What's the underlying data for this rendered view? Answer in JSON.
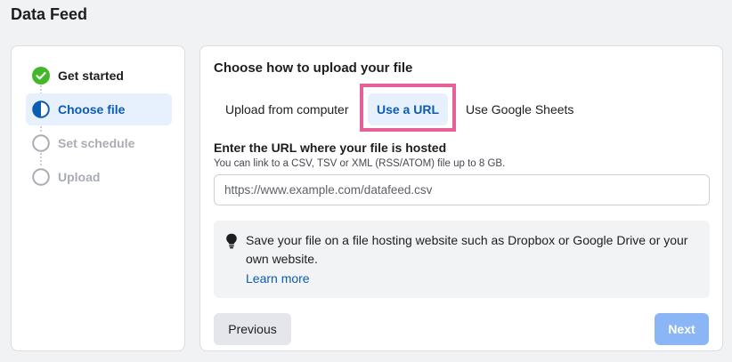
{
  "page": {
    "title": "Data Feed"
  },
  "steps": [
    {
      "label": "Get started",
      "state": "complete",
      "icon": "check-circle-icon"
    },
    {
      "label": "Choose file",
      "state": "current",
      "icon": "half-circle-icon"
    },
    {
      "label": "Set schedule",
      "state": "pending",
      "icon": "empty-circle-icon"
    },
    {
      "label": "Upload",
      "state": "pending",
      "icon": "empty-circle-icon"
    }
  ],
  "main": {
    "heading": "Choose how to upload your file",
    "tabs": [
      {
        "label": "Upload from computer",
        "selected": false
      },
      {
        "label": "Use a URL",
        "selected": true
      },
      {
        "label": "Use Google Sheets",
        "selected": false
      }
    ],
    "url_field": {
      "label": "Enter the URL where your file is hosted",
      "help": "You can link to a CSV, TSV or XML (RSS/ATOM) file up to 8 GB.",
      "placeholder": "https://www.example.com/datafeed.csv",
      "value": ""
    },
    "tip": {
      "icon": "lightbulb-icon",
      "text": "Save your file on a file hosting website such as Dropbox or Google Drive or your own website.",
      "link": "Learn more"
    },
    "buttons": {
      "previous": "Previous",
      "next": "Next"
    }
  },
  "colors": {
    "accent": "#0b5cb5",
    "selected_bg": "#e7f0fd",
    "success": "#42b72a",
    "highlight_border": "#e56197",
    "next_disabled": "#8ab6f6"
  }
}
